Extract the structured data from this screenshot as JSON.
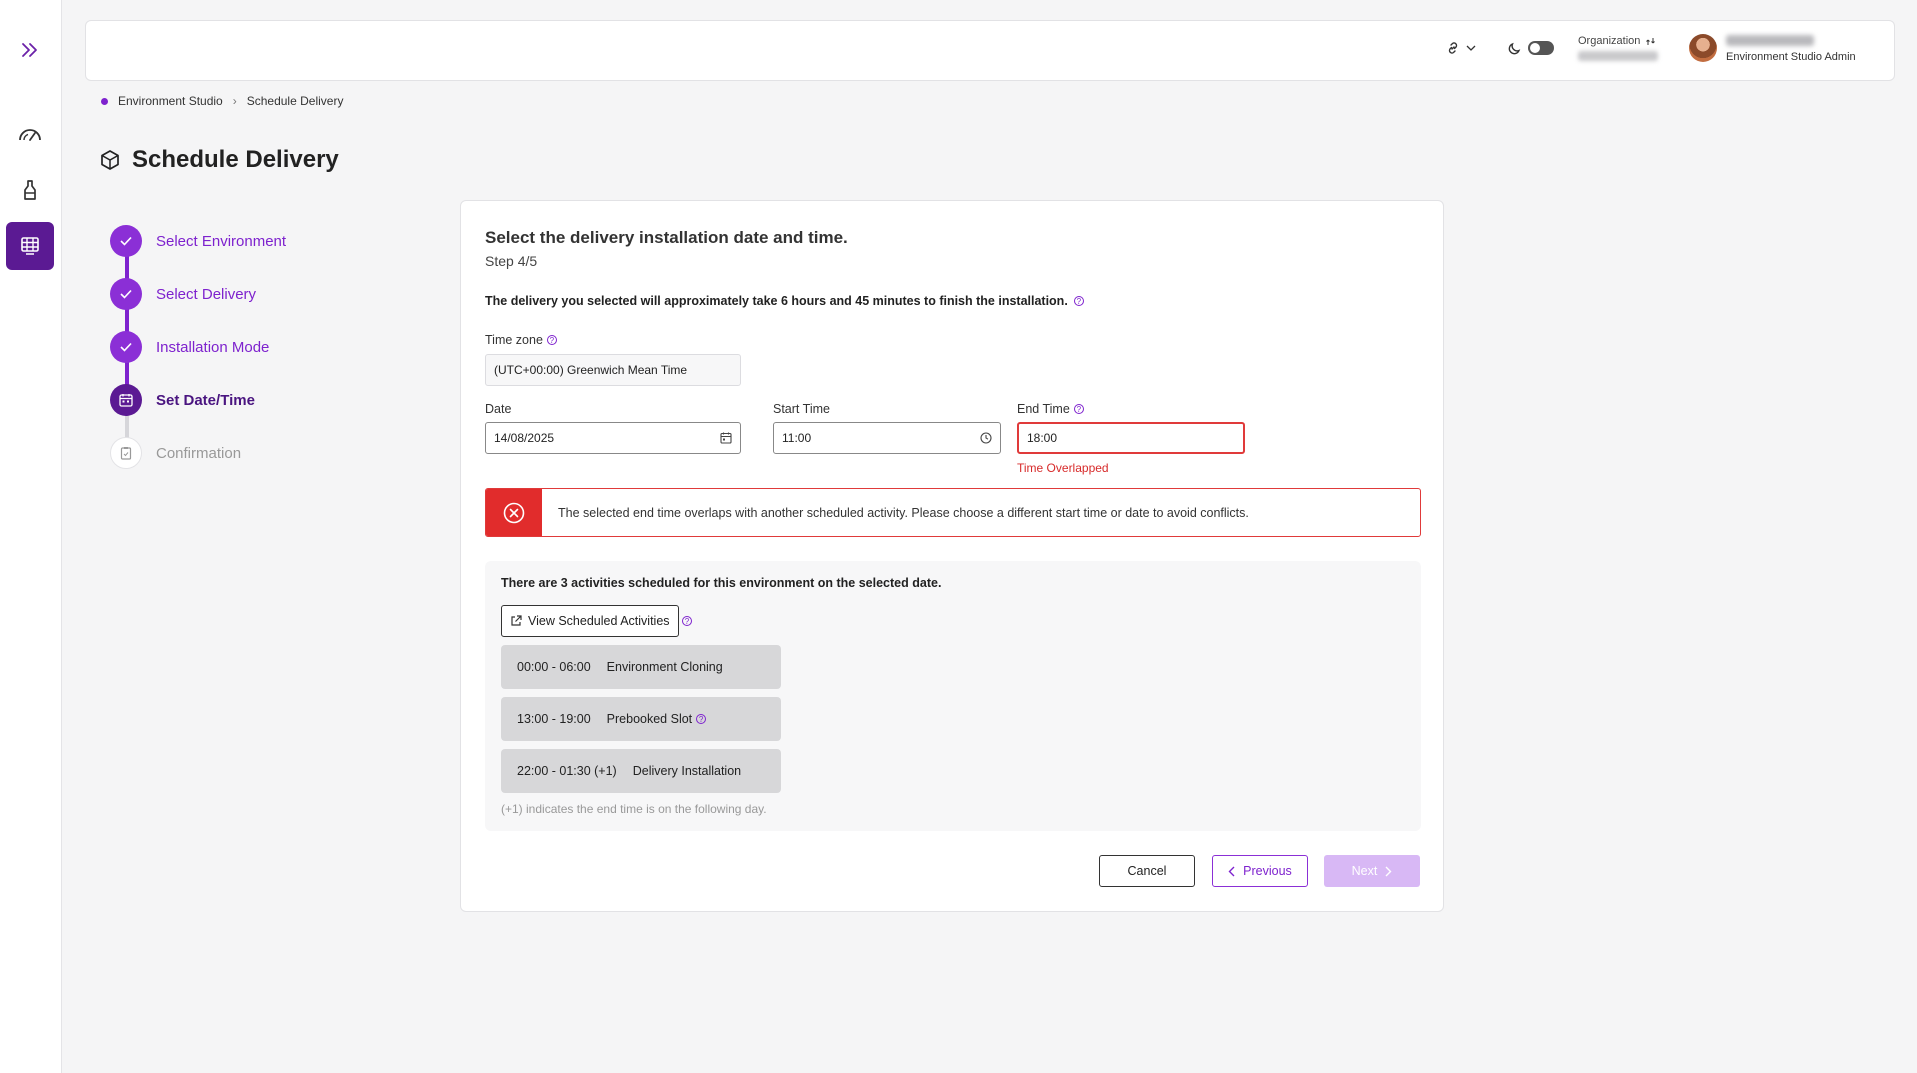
{
  "header": {
    "org_label": "Organization",
    "user_role": "Environment Studio Admin"
  },
  "breadcrumb": [
    "Environment Studio",
    "Schedule Delivery"
  ],
  "page_title": "Schedule Delivery",
  "stepper": [
    {
      "label": "Select Environment",
      "state": "done"
    },
    {
      "label": "Select Delivery",
      "state": "done"
    },
    {
      "label": "Installation Mode",
      "state": "done"
    },
    {
      "label": "Set Date/Time",
      "state": "current"
    },
    {
      "label": "Confirmation",
      "state": "future"
    }
  ],
  "card": {
    "title": "Select the delivery installation  date and time.",
    "step": "Step 4/5",
    "info": "The delivery you selected will approximately take 6 hours and 45 minutes to finish the installation."
  },
  "form": {
    "timezone_label": "Time zone",
    "timezone_value": "(UTC+00:00) Greenwich Mean Time",
    "date_label": "Date",
    "date_value": "14/08/2025",
    "start_label": "Start Time",
    "start_value": "11:00",
    "end_label": "End Time",
    "end_value": "18:00",
    "end_error": "Time Overlapped"
  },
  "alert": {
    "text": "The selected end time overlaps with another scheduled activity. Please choose a different start time or date to avoid conflicts."
  },
  "activities": {
    "title": "There are 3 activities  scheduled for this environment on the selected date.",
    "view_button": "View Scheduled Activities",
    "items": [
      {
        "time": "00:00 - 06:00",
        "name": "Environment Cloning"
      },
      {
        "time": "13:00 - 19:00",
        "name": "Prebooked Slot"
      },
      {
        "time": "22:00 - 01:30 (+1)",
        "name": "Delivery Installation"
      }
    ],
    "note": "(+1) indicates the end time is on the following day."
  },
  "buttons": {
    "cancel": "Cancel",
    "previous": "Previous",
    "next": "Next"
  },
  "colors": {
    "accent": "#7e22ce",
    "accent_dark": "#5b1a93",
    "error": "#e03a3a"
  }
}
